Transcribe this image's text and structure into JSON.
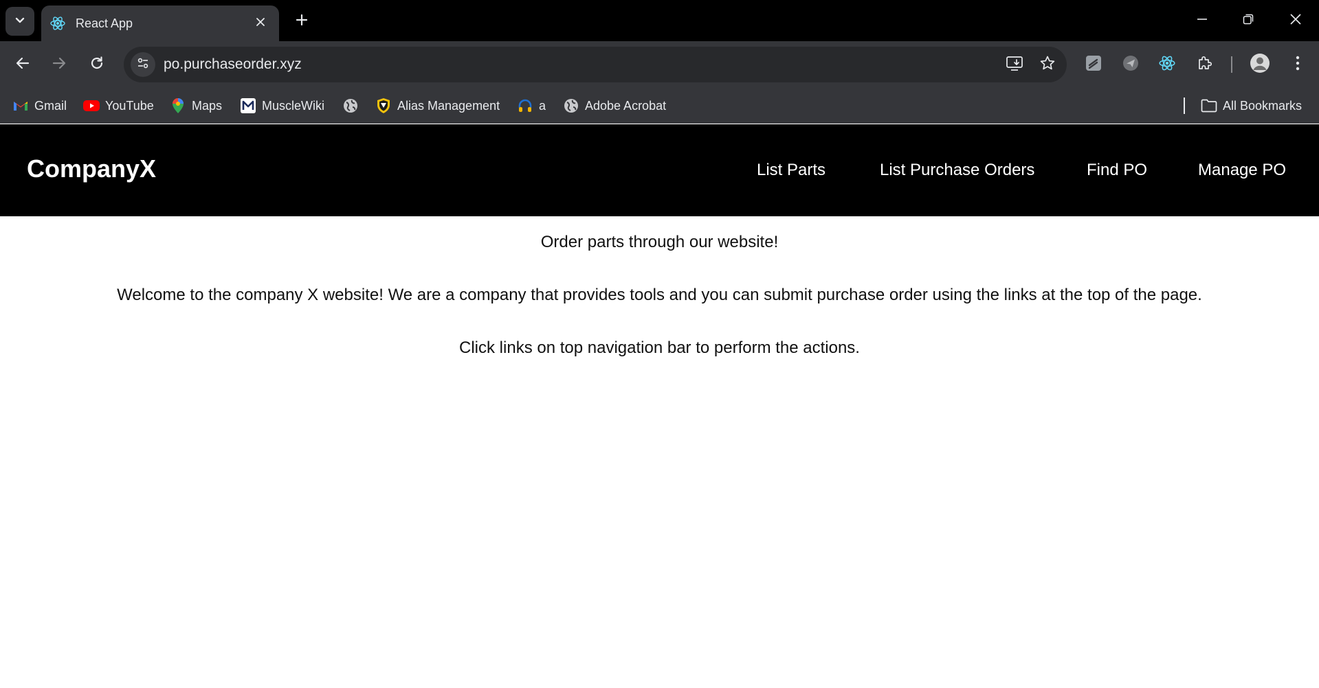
{
  "browser": {
    "tab": {
      "title": "React App"
    },
    "address": {
      "url": "po.purchaseorder.xyz"
    },
    "bookmarks": [
      {
        "label": "Gmail",
        "icon": "gmail-icon"
      },
      {
        "label": "YouTube",
        "icon": "youtube-icon"
      },
      {
        "label": "Maps",
        "icon": "maps-icon"
      },
      {
        "label": "MuscleWiki",
        "icon": "musclewiki-icon"
      },
      {
        "label": "",
        "icon": "globe-icon"
      },
      {
        "label": "Alias Management",
        "icon": "shield-icon"
      },
      {
        "label": "a",
        "icon": "headset-icon"
      },
      {
        "label": "Adobe Acrobat",
        "icon": "globe-icon"
      }
    ],
    "all_bookmarks": "All Bookmarks",
    "colors": {
      "tabstrip": "#000000",
      "toolbar": "#35363a",
      "omnibox": "#28292c",
      "react_blue": "#61dafb"
    }
  },
  "site": {
    "brand": "CompanyX",
    "nav": {
      "list_parts": "List Parts",
      "list_purchase_orders": "List Purchase Orders",
      "find_po": "Find PO",
      "manage_po": "Manage PO"
    },
    "content": {
      "heading": "Order parts through our website!",
      "welcome": "Welcome to the company X website! We are a company that provides tools and you can submit purchase order using the links at the top of the page.",
      "instructions": "Click links on top navigation bar to perform the actions."
    }
  }
}
